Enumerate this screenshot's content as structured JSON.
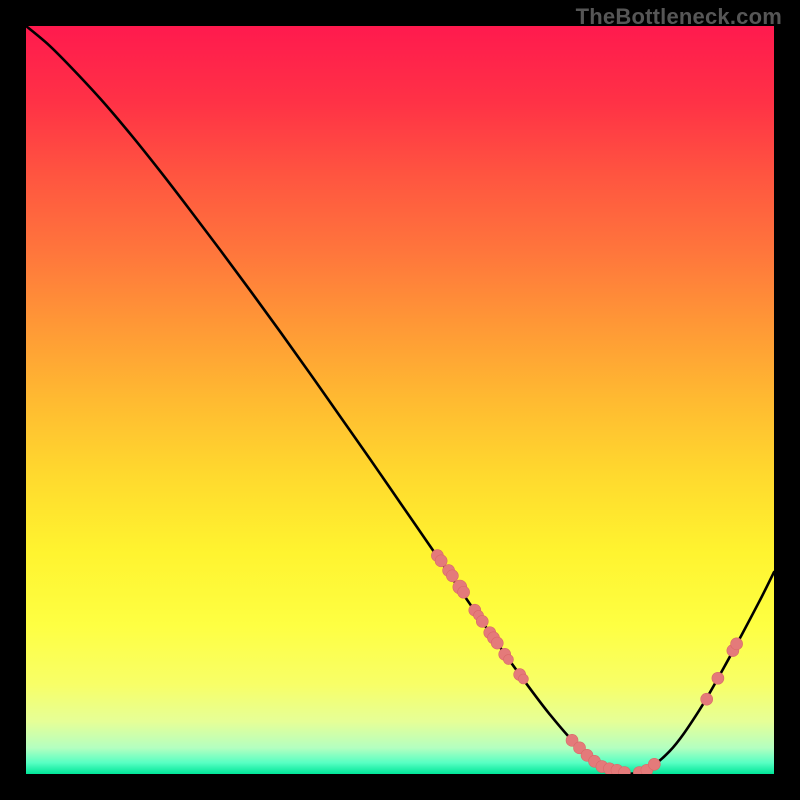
{
  "watermark": "TheBottleneck.com",
  "chart_data": {
    "type": "line",
    "title": "",
    "xlabel": "",
    "ylabel": "",
    "xlim": [
      0,
      100
    ],
    "ylim": [
      0,
      100
    ],
    "series": [
      {
        "name": "curve",
        "x": [
          0,
          3,
          6,
          10,
          14,
          18,
          22,
          26,
          30,
          34,
          38,
          42,
          46,
          50,
          54,
          58,
          62,
          66,
          70,
          74,
          78,
          82,
          86,
          90,
          94,
          98,
          100
        ],
        "y": [
          100,
          97.5,
          94.5,
          90.2,
          85.5,
          80.5,
          75.3,
          70.0,
          64.6,
          59.1,
          53.5,
          47.8,
          42.1,
          36.3,
          30.5,
          24.7,
          18.9,
          13.3,
          8.0,
          3.5,
          0.7,
          0.2,
          3.0,
          8.5,
          15.5,
          23.0,
          27.0
        ]
      }
    ],
    "scatter_points": [
      {
        "x": 55,
        "y": 29.2,
        "r": 6
      },
      {
        "x": 55.5,
        "y": 28.5,
        "r": 6
      },
      {
        "x": 56.5,
        "y": 27.2,
        "r": 6
      },
      {
        "x": 57,
        "y": 26.5,
        "r": 6
      },
      {
        "x": 58,
        "y": 25.0,
        "r": 7
      },
      {
        "x": 58.5,
        "y": 24.3,
        "r": 6
      },
      {
        "x": 60,
        "y": 21.9,
        "r": 6
      },
      {
        "x": 60.5,
        "y": 21.2,
        "r": 5
      },
      {
        "x": 61,
        "y": 20.4,
        "r": 6
      },
      {
        "x": 62,
        "y": 18.9,
        "r": 6
      },
      {
        "x": 62.5,
        "y": 18.2,
        "r": 6
      },
      {
        "x": 63,
        "y": 17.5,
        "r": 6
      },
      {
        "x": 64,
        "y": 16.0,
        "r": 6
      },
      {
        "x": 64.5,
        "y": 15.3,
        "r": 5
      },
      {
        "x": 66,
        "y": 13.3,
        "r": 6
      },
      {
        "x": 66.5,
        "y": 12.7,
        "r": 5
      },
      {
        "x": 73,
        "y": 4.5,
        "r": 6
      },
      {
        "x": 74,
        "y": 3.5,
        "r": 6
      },
      {
        "x": 75,
        "y": 2.5,
        "r": 6
      },
      {
        "x": 76,
        "y": 1.7,
        "r": 6
      },
      {
        "x": 77,
        "y": 1.0,
        "r": 6
      },
      {
        "x": 78,
        "y": 0.7,
        "r": 6
      },
      {
        "x": 79,
        "y": 0.5,
        "r": 6
      },
      {
        "x": 80,
        "y": 0.2,
        "r": 6
      },
      {
        "x": 82,
        "y": 0.2,
        "r": 6
      },
      {
        "x": 83,
        "y": 0.5,
        "r": 6
      },
      {
        "x": 84,
        "y": 1.3,
        "r": 6
      },
      {
        "x": 91,
        "y": 10.0,
        "r": 6
      },
      {
        "x": 92.5,
        "y": 12.8,
        "r": 6
      },
      {
        "x": 94.5,
        "y": 16.5,
        "r": 6
      },
      {
        "x": 95,
        "y": 17.4,
        "r": 6
      }
    ],
    "gradient_stops": [
      {
        "offset": 0.0,
        "color": "#ff1a4e"
      },
      {
        "offset": 0.1,
        "color": "#ff3146"
      },
      {
        "offset": 0.2,
        "color": "#ff5540"
      },
      {
        "offset": 0.3,
        "color": "#ff753c"
      },
      {
        "offset": 0.4,
        "color": "#ff9836"
      },
      {
        "offset": 0.5,
        "color": "#ffba31"
      },
      {
        "offset": 0.6,
        "color": "#ffd92e"
      },
      {
        "offset": 0.7,
        "color": "#fff32f"
      },
      {
        "offset": 0.8,
        "color": "#feff42"
      },
      {
        "offset": 0.88,
        "color": "#f8ff67"
      },
      {
        "offset": 0.93,
        "color": "#e6ff97"
      },
      {
        "offset": 0.965,
        "color": "#b4ffc0"
      },
      {
        "offset": 0.985,
        "color": "#57ffc3"
      },
      {
        "offset": 1.0,
        "color": "#00e598"
      }
    ],
    "colors": {
      "curve": "#000000",
      "points_fill": "#e47a7a",
      "points_stroke": "#d96868"
    }
  }
}
